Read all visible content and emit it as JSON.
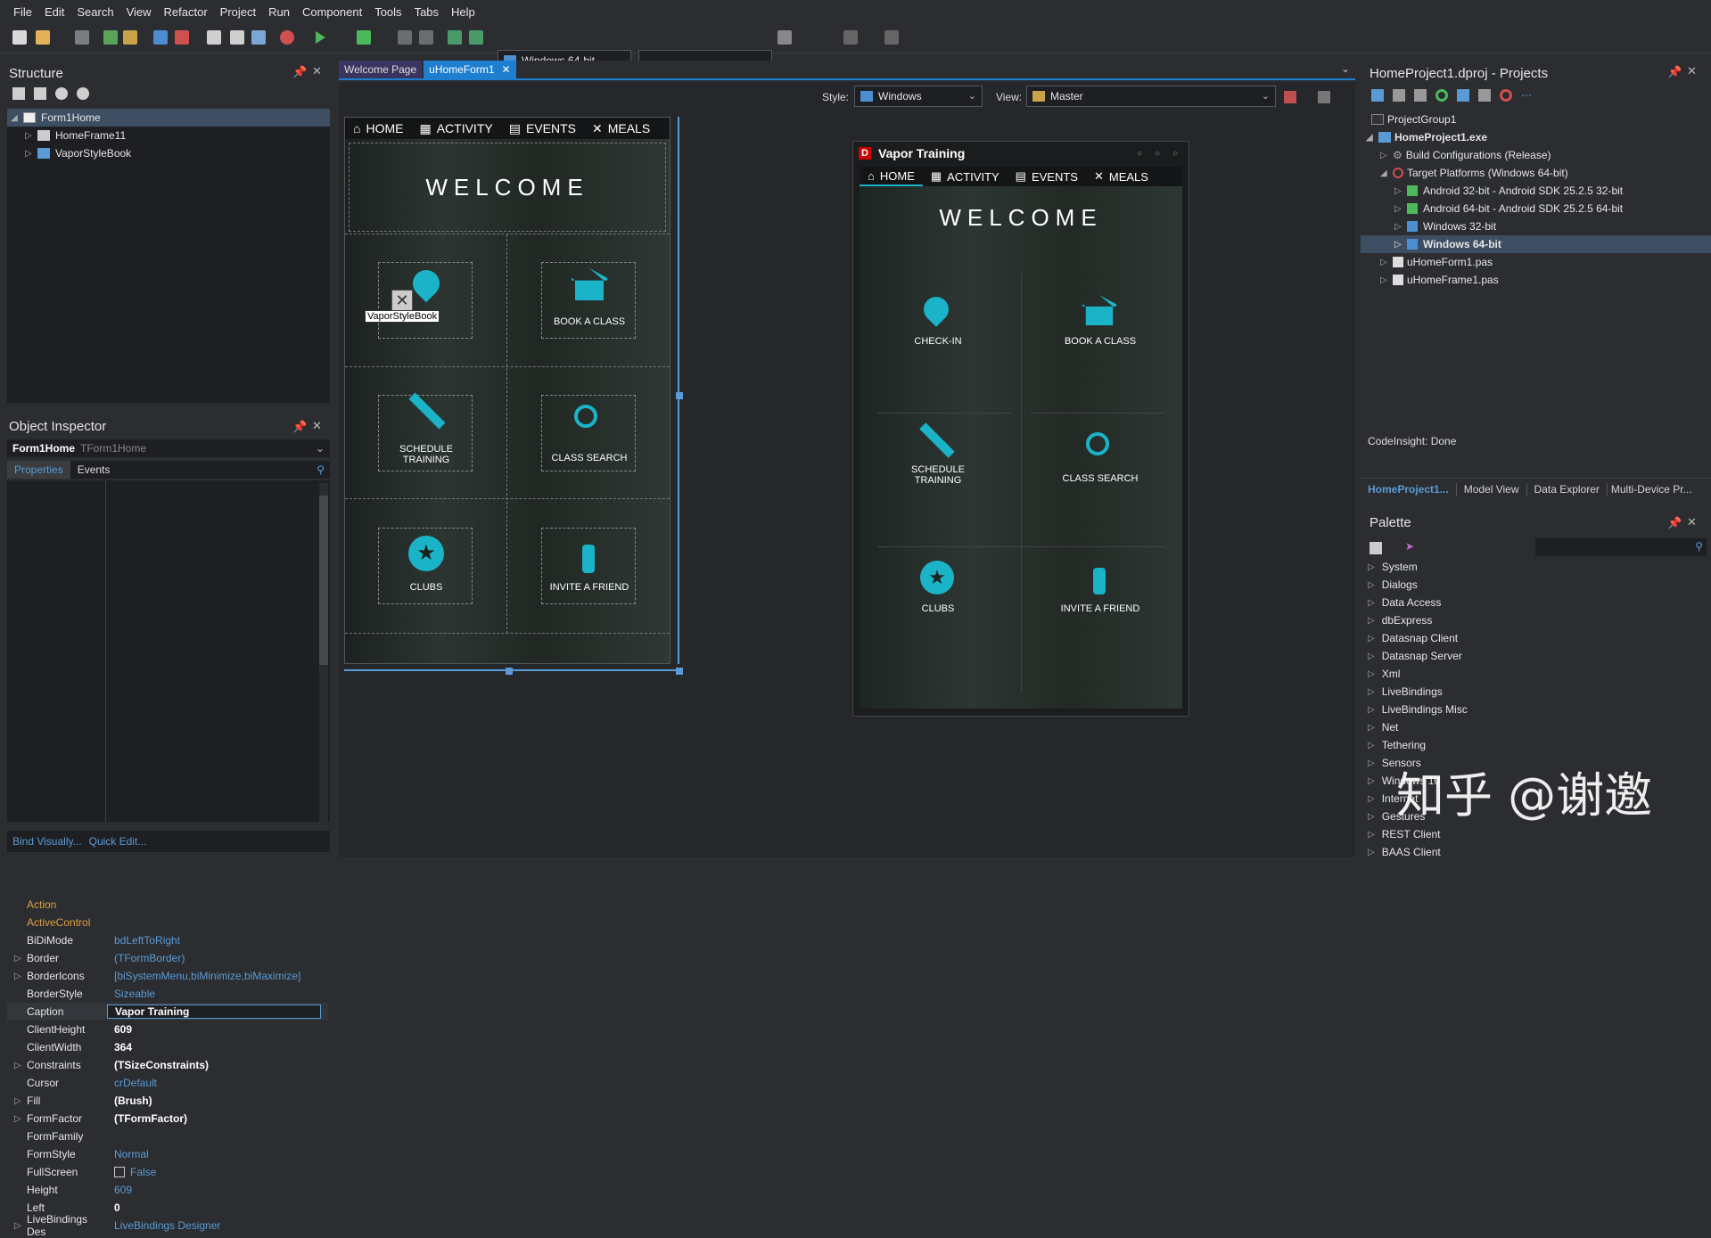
{
  "menu": [
    "File",
    "Edit",
    "Search",
    "View",
    "Refactor",
    "Project",
    "Run",
    "Component",
    "Tools",
    "Tabs",
    "Help"
  ],
  "toolbar": {
    "platform": "Windows 64-bit",
    "config": ""
  },
  "structure": {
    "title": "Structure",
    "items": [
      "Form1Home",
      "HomeFrame11",
      "VaporStyleBook"
    ]
  },
  "inspector": {
    "title": "Object Inspector",
    "object": "Form1Home",
    "object_type": "TForm1Home",
    "tab_properties": "Properties",
    "tab_events": "Events",
    "rows": [
      {
        "k": "Action",
        "v": ""
      },
      {
        "k": "ActiveControl",
        "v": ""
      },
      {
        "k": "BiDiMode",
        "v": "bdLeftToRight"
      },
      {
        "k": "Border",
        "v": "(TFormBorder)"
      },
      {
        "k": "BorderIcons",
        "v": "[biSystemMenu,biMinimize,biMaximize]"
      },
      {
        "k": "BorderStyle",
        "v": "Sizeable"
      },
      {
        "k": "Caption",
        "v": "Vapor Training"
      },
      {
        "k": "ClientHeight",
        "v": "609"
      },
      {
        "k": "ClientWidth",
        "v": "364"
      },
      {
        "k": "Constraints",
        "v": "(TSizeConstraints)"
      },
      {
        "k": "Cursor",
        "v": "crDefault"
      },
      {
        "k": "Fill",
        "v": "(Brush)"
      },
      {
        "k": "FormFactor",
        "v": "(TFormFactor)"
      },
      {
        "k": "FormFamily",
        "v": ""
      },
      {
        "k": "FormStyle",
        "v": "Normal"
      },
      {
        "k": "FullScreen",
        "v": "False"
      },
      {
        "k": "Height",
        "v": "609"
      },
      {
        "k": "Left",
        "v": "0"
      },
      {
        "k": "LiveBindings Des",
        "v": "LiveBindings Designer"
      }
    ],
    "bind_visually": "Bind Visually...",
    "quick_edit": "Quick Edit..."
  },
  "editor": {
    "tabs": [
      "Welcome Page",
      "uHomeForm1"
    ],
    "style_label": "Style:",
    "style_value": "Windows",
    "view_label": "View:",
    "view_value": "Master"
  },
  "app": {
    "nav": [
      "HOME",
      "ACTIVITY",
      "EVENTS",
      "MEALS"
    ],
    "welcome": "WELCOME",
    "tiles": [
      "CHECK-IN",
      "BOOK A CLASS",
      "SCHEDULE TRAINING",
      "CLASS SEARCH",
      "CLUBS",
      "INVITE A FRIEND"
    ],
    "tooltip": "VaporStyleBook",
    "preview_title": "Vapor Training",
    "preview_logo": "D"
  },
  "projects": {
    "title": "HomeProject1.dproj - Projects",
    "items": [
      "ProjectGroup1",
      "HomeProject1.exe",
      "Build Configurations (Release)",
      "Target Platforms (Windows 64-bit)",
      "Android 32-bit - Android SDK 25.2.5 32-bit",
      "Android 64-bit - Android SDK 25.2.5 64-bit",
      "Windows 32-bit",
      "Windows 64-bit",
      "uHomeForm1.pas",
      "uHomeFrame1.pas"
    ],
    "status": "CodeInsight: Done",
    "bottom_tabs": [
      "HomeProject1...",
      "Model View",
      "Data Explorer",
      "Multi-Device Pr..."
    ]
  },
  "palette": {
    "title": "Palette",
    "items": [
      "System",
      "Dialogs",
      "Data Access",
      "dbExpress",
      "Datasnap Client",
      "Datasnap Server",
      "Xml",
      "LiveBindings",
      "LiveBindings Misc",
      "Net",
      "Tethering",
      "Sensors",
      "Windows 10",
      "Internet",
      "Gestures",
      "REST Client",
      "BAAS Client"
    ]
  },
  "watermark": "知乎 @谢邀",
  "colors": {
    "accent": "#1ab3c8",
    "selection": "#3d4e63",
    "orange": "#e0a040",
    "link": "#5b9bd5"
  }
}
